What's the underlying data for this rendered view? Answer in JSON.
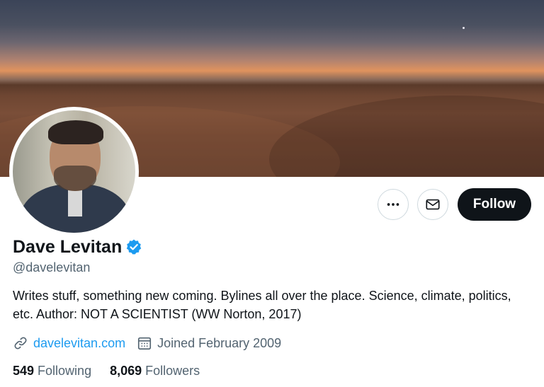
{
  "profile": {
    "name": "Dave Levitan",
    "handle": "@davelevitan",
    "bio": "Writes stuff, something new coming. Bylines all over the place. Science, climate, politics, etc. Author: NOT A SCIENTIST (WW Norton, 2017)",
    "website": "davelevitan.com",
    "joined": "Joined February 2009",
    "verified": true
  },
  "actions": {
    "follow_label": "Follow",
    "more_icon": "more-horizontal-icon",
    "message_icon": "envelope-icon"
  },
  "stats": {
    "following_count": "549",
    "following_label": "Following",
    "followers_count": "8,069",
    "followers_label": "Followers"
  },
  "icons": {
    "verified": "verified-badge-icon",
    "link": "link-icon",
    "calendar": "calendar-icon"
  },
  "colors": {
    "accent": "#1d9bf0",
    "primary_text": "#0f1419",
    "secondary_text": "#536471",
    "follow_button_bg": "#0f1419"
  }
}
